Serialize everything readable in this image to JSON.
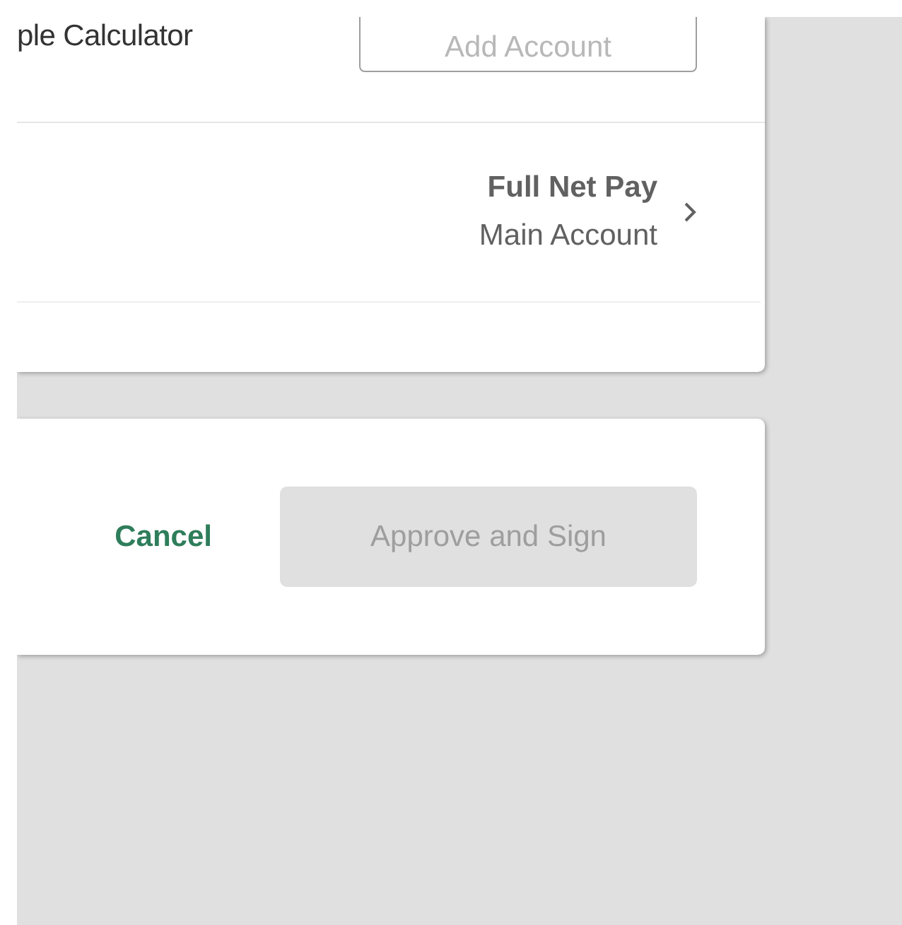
{
  "header": {
    "title": "ple Calculator",
    "add_button": "Add Account"
  },
  "allocation": {
    "amount": "Full Net Pay",
    "account": "Main Account"
  },
  "actions": {
    "cancel": "Cancel",
    "approve": {
      "label": "Approve and Sign",
      "disabled": true
    }
  }
}
